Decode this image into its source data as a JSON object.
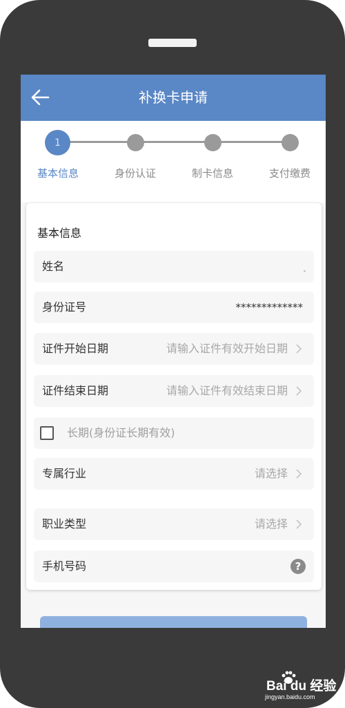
{
  "header": {
    "title": "补换卡申请",
    "back_icon": "arrow-left-icon"
  },
  "stepper": {
    "active_step_number": "1",
    "steps": [
      {
        "label": "基本信息",
        "active": true
      },
      {
        "label": "身份认证",
        "active": false
      },
      {
        "label": "制卡信息",
        "active": false
      },
      {
        "label": "支付缴费",
        "active": false
      }
    ]
  },
  "form": {
    "section_title": "基本信息",
    "name": {
      "label": "姓名",
      "value": ""
    },
    "id_number": {
      "label": "身份证号",
      "value": "*************"
    },
    "id_start_date": {
      "label": "证件开始日期",
      "placeholder": "请输入证件有效开始日期"
    },
    "id_end_date": {
      "label": "证件结束日期",
      "placeholder": "请输入证件有效结束日期"
    },
    "long_term": {
      "label": "长期(身份证长期有效)",
      "checked": false
    },
    "industry": {
      "label": "专属行业",
      "placeholder": "请选择"
    },
    "occupation": {
      "label": "职业类型",
      "placeholder": "请选择"
    },
    "phone": {
      "label": "手机号码",
      "value": ""
    }
  },
  "watermark": {
    "brand": "Bai du 经验",
    "site": "jingyan.baidu.com"
  },
  "colors": {
    "primary": "#5a87c5",
    "inactive": "#9a9a9a",
    "button": "#8fb1e0"
  }
}
